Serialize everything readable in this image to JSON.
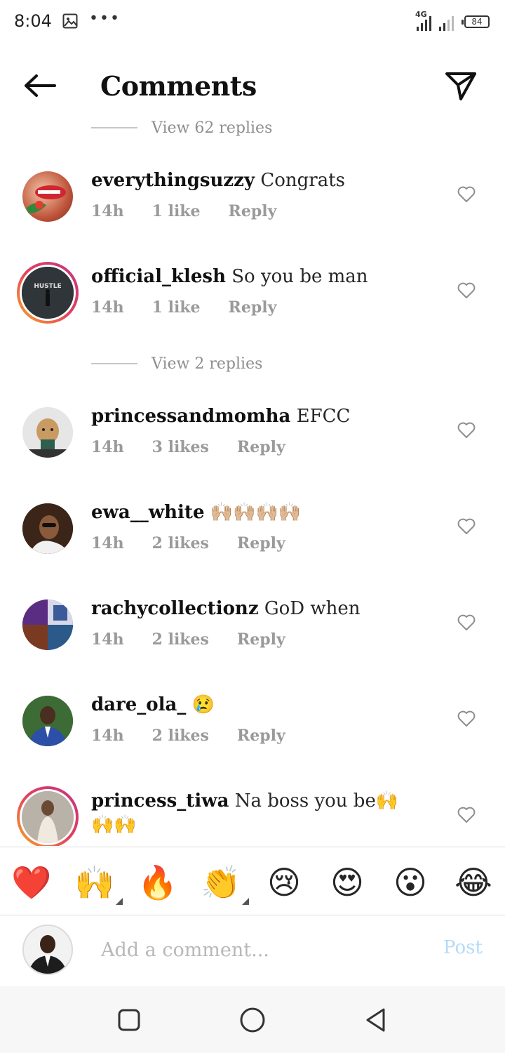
{
  "status": {
    "time": "8:04",
    "dots": "•••",
    "network": "4G",
    "battery": "84"
  },
  "header": {
    "title": "Comments"
  },
  "view_replies": [
    {
      "label": "View 62 replies"
    },
    {
      "label": "View 2 replies"
    }
  ],
  "comments": [
    {
      "username": "everythingsuzzy",
      "text": "Congrats",
      "time": "14h",
      "likes": "1 like",
      "reply": "Reply"
    },
    {
      "username": "official_klesh",
      "text": "So you be man",
      "time": "14h",
      "likes": "1 like",
      "reply": "Reply"
    },
    {
      "username": "princessandmomha",
      "text": "EFCC",
      "time": "14h",
      "likes": "3 likes",
      "reply": "Reply"
    },
    {
      "username": "ewa__white",
      "text": "🙌🏼🙌🏼🙌🏼🙌🏼",
      "time": "14h",
      "likes": "2 likes",
      "reply": "Reply"
    },
    {
      "username": "rachycollectionz",
      "text": "GoD when",
      "time": "14h",
      "likes": "2 likes",
      "reply": "Reply"
    },
    {
      "username": "dare_ola_",
      "text": "😢",
      "time": "14h",
      "likes": "2 likes",
      "reply": "Reply"
    },
    {
      "username": "princess_tiwa",
      "text": "Na boss you be🙌🙌🙌",
      "time": "",
      "likes": "",
      "reply": ""
    }
  ],
  "emoji_bar": [
    "❤️",
    "🙌",
    "🔥",
    "👏",
    "😢",
    "😍",
    "😮",
    "😂"
  ],
  "input": {
    "placeholder": "Add a comment...",
    "post_label": "Post"
  },
  "colors": {
    "story_ring": "#e4405f",
    "post_disabled": "#b3dbf8",
    "meta_gray": "#9a9a9a"
  }
}
